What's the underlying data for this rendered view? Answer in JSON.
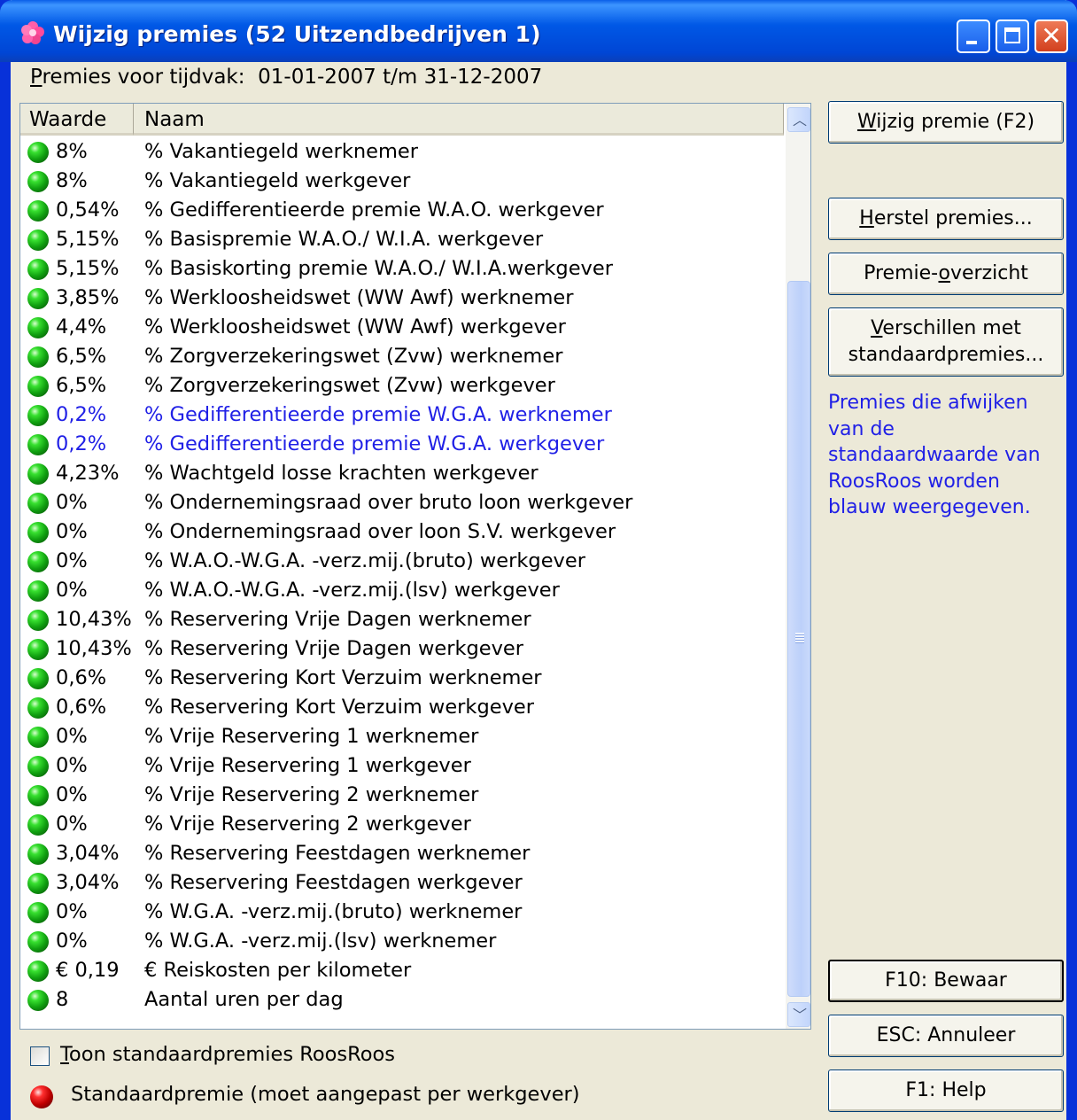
{
  "window": {
    "title": "Wijzig premies (52 Uitzendbedrijven 1)",
    "icon": "flower-icon"
  },
  "period": {
    "label_first": "P",
    "label_rest": "remies voor tijdvak:",
    "value": "01-01-2007 t/m 31-12-2007"
  },
  "table": {
    "columns": [
      "Waarde",
      "Naam"
    ],
    "rows": [
      {
        "value": "8%",
        "name": "% Vakantiegeld werknemer",
        "blue": false
      },
      {
        "value": "8%",
        "name": "% Vakantiegeld werkgever",
        "blue": false
      },
      {
        "value": "0,54%",
        "name": "% Gedifferentieerde premie W.A.O. werkgever",
        "blue": false
      },
      {
        "value": "5,15%",
        "name": "% Basispremie W.A.O./ W.I.A. werkgever",
        "blue": false
      },
      {
        "value": "5,15%",
        "name": "% Basiskorting premie W.A.O./ W.I.A.werkgever",
        "blue": false
      },
      {
        "value": "3,85%",
        "name": "% Werkloosheidswet (WW Awf) werknemer",
        "blue": false
      },
      {
        "value": "4,4%",
        "name": "% Werkloosheidswet (WW Awf) werkgever",
        "blue": false
      },
      {
        "value": "6,5%",
        "name": "% Zorgverzekeringswet (Zvw) werknemer",
        "blue": false
      },
      {
        "value": "6,5%",
        "name": "% Zorgverzekeringswet (Zvw) werkgever",
        "blue": false
      },
      {
        "value": "0,2%",
        "name": "% Gedifferentieerde premie W.G.A. werknemer",
        "blue": true
      },
      {
        "value": "0,2%",
        "name": "% Gedifferentieerde premie W.G.A. werkgever",
        "blue": true
      },
      {
        "value": "4,23%",
        "name": "% Wachtgeld losse krachten werkgever",
        "blue": false
      },
      {
        "value": "0%",
        "name": "% Ondernemingsraad over bruto loon werkgever",
        "blue": false
      },
      {
        "value": "0%",
        "name": "% Ondernemingsraad over loon S.V. werkgever",
        "blue": false
      },
      {
        "value": "0%",
        "name": "% W.A.O.-W.G.A. -verz.mij.(bruto) werkgever",
        "blue": false
      },
      {
        "value": "0%",
        "name": "% W.A.O.-W.G.A. -verz.mij.(lsv) werkgever",
        "blue": false
      },
      {
        "value": "10,43%",
        "name": "% Reservering Vrije Dagen werknemer",
        "blue": false
      },
      {
        "value": "10,43%",
        "name": "% Reservering Vrije Dagen werkgever",
        "blue": false
      },
      {
        "value": "0,6%",
        "name": "% Reservering Kort Verzuim werknemer",
        "blue": false
      },
      {
        "value": "0,6%",
        "name": "% Reservering Kort Verzuim werkgever",
        "blue": false
      },
      {
        "value": "0%",
        "name": "% Vrije Reservering 1 werknemer",
        "blue": false
      },
      {
        "value": "0%",
        "name": "% Vrije Reservering 1 werkgever",
        "blue": false
      },
      {
        "value": "0%",
        "name": "% Vrije Reservering 2 werknemer",
        "blue": false
      },
      {
        "value": "0%",
        "name": "% Vrije Reservering 2 werkgever",
        "blue": false
      },
      {
        "value": "3,04%",
        "name": "% Reservering Feestdagen werknemer",
        "blue": false
      },
      {
        "value": "3,04%",
        "name": "% Reservering Feestdagen werkgever",
        "blue": false
      },
      {
        "value": "0%",
        "name": "% W.G.A. -verz.mij.(bruto) werknemer",
        "blue": false
      },
      {
        "value": "0%",
        "name": "% W.G.A. -verz.mij.(lsv) werknemer",
        "blue": false
      },
      {
        "value": "€ 0,19",
        "name": "€ Reiskosten per kilometer",
        "blue": false
      },
      {
        "value": "8",
        "name": "Aantal uren per dag",
        "blue": false
      }
    ]
  },
  "buttons": {
    "wijzig": {
      "mn": "W",
      "rest": "ijzig premie (F2)"
    },
    "herstel": {
      "mn": "H",
      "rest": "erstel premies..."
    },
    "overzicht": {
      "pre": "Premie-",
      "mn": "o",
      "rest": "verzicht"
    },
    "verschillen": {
      "mn": "V",
      "rest": "erschillen met",
      "line2": "standaardpremies..."
    },
    "bewaar": "F10: Bewaar",
    "annuleer": "ESC: Annuleer",
    "help": "F1: Help"
  },
  "note": "Premies die afwijken van de standaardwaarde van RoosRoos worden blauw weergegeven.",
  "checkbox": {
    "mn": "T",
    "rest": "oon standaardpremies RoosRoos",
    "checked": false
  },
  "legend": "Standaardpremie (moet aangepast per werkgever)",
  "colors": {
    "titlebar": "#0058e6",
    "deviation_text": "#2020e6",
    "ok_dot": "#10a010",
    "warn_dot": "#c00000"
  }
}
